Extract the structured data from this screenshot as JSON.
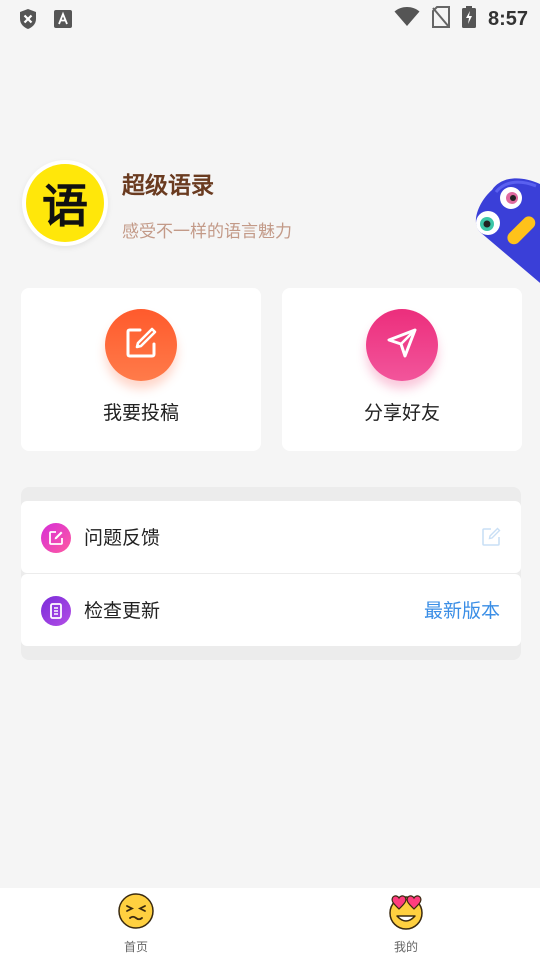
{
  "status_bar": {
    "time": "8:57"
  },
  "profile": {
    "logo_char": "语",
    "app_name": "超级语录",
    "slogan": "感受不一样的语言魅力"
  },
  "actions": [
    {
      "label": "我要投稿",
      "icon": "edit-icon",
      "color": "#ff6a3d"
    },
    {
      "label": "分享好友",
      "icon": "send-icon",
      "color": "#ec3c85"
    }
  ],
  "settings_list": [
    {
      "label": "问题反馈",
      "icon": "feedback-icon",
      "right_icon": "edit-icon"
    },
    {
      "label": "检查更新",
      "icon": "update-icon",
      "value": "最新版本"
    }
  ],
  "bottom_nav": [
    {
      "label": "首页",
      "icon": "squint-emoji-icon"
    },
    {
      "label": "我的",
      "icon": "heart-eyes-emoji-icon"
    }
  ]
}
